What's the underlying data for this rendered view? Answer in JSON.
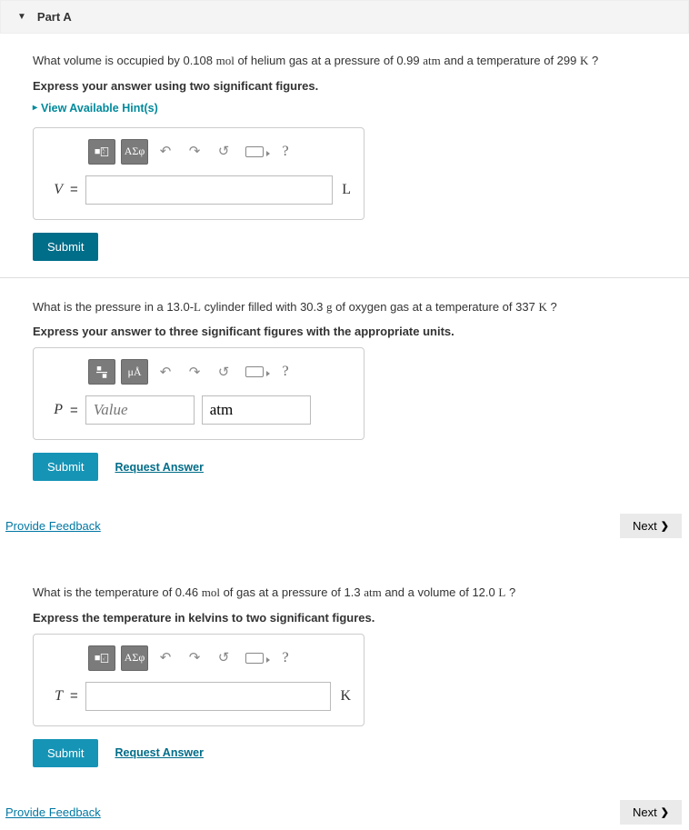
{
  "partA": {
    "title": "Part A",
    "question_pre": "What volume is occupied by 0.108 ",
    "q_unit1": "mol",
    "question_mid1": " of helium gas at a pressure of 0.99 ",
    "q_unit2": "atm",
    "question_mid2": " and a temperature of 299 ",
    "q_unit3": "K",
    "question_end": " ?",
    "instruction": "Express your answer using two significant figures.",
    "hint": "View Available Hint(s)",
    "toolbar": {
      "greek": "ΑΣφ",
      "help": "?"
    },
    "var": "V",
    "eq": "=",
    "unit": "L",
    "submit": "Submit"
  },
  "partB": {
    "question_pre": "What is the pressure in a 13.0-",
    "q_unit1": "L",
    "question_mid1": " cylinder filled with 30.3 ",
    "q_unit2": "g",
    "question_mid2": " of oxygen gas at a temperature of 337 ",
    "q_unit3": "K",
    "question_end": " ?",
    "instruction": "Express your answer to three significant figures with the appropriate units.",
    "toolbar": {
      "units": "μÅ",
      "help": "?"
    },
    "var": "P",
    "eq": "=",
    "value_ph": "Value",
    "unit_value": "atm",
    "submit": "Submit",
    "request": "Request Answer"
  },
  "footer": {
    "provide": "Provide Feedback",
    "next": "Next"
  },
  "partC": {
    "question_pre": "What is the temperature of 0.46 ",
    "q_unit1": "mol",
    "question_mid1": " of gas at a pressure of 1.3 ",
    "q_unit2": "atm",
    "question_mid2": " and a volume of 12.0 ",
    "q_unit3": "L",
    "question_end": " ?",
    "instruction": "Express the temperature in kelvins to two significant figures.",
    "toolbar": {
      "greek": "ΑΣφ",
      "help": "?"
    },
    "var": "T",
    "eq": "=",
    "unit": "K",
    "submit": "Submit",
    "request": "Request Answer"
  }
}
